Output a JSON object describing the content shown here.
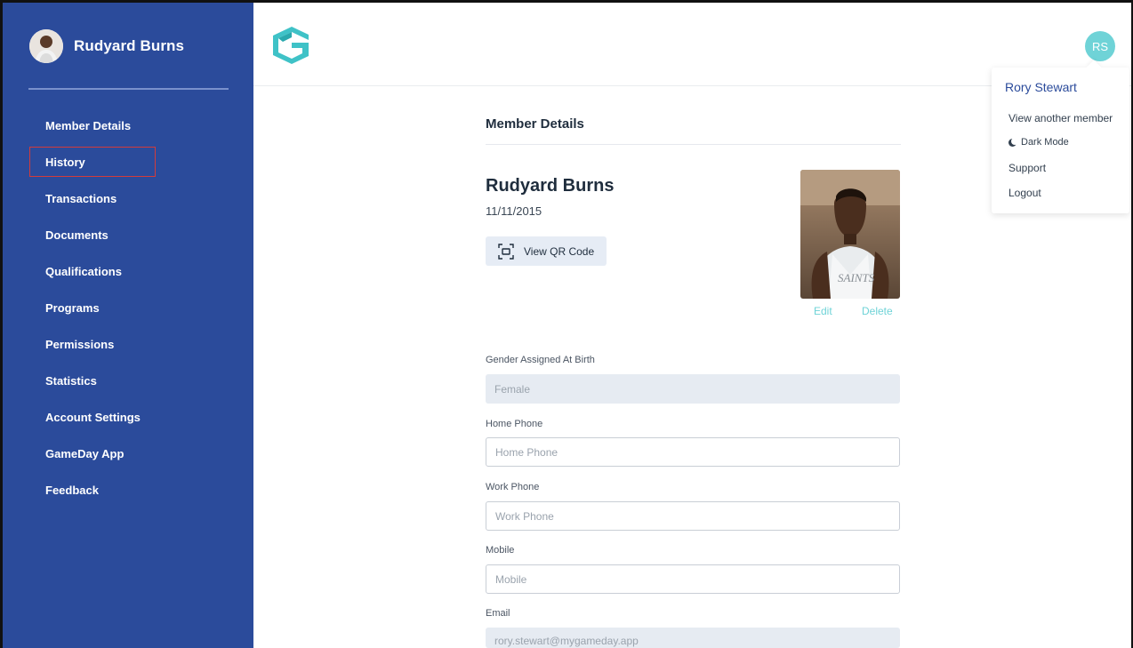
{
  "sidebar": {
    "profile_name": "Rudyard Burns",
    "items": [
      {
        "label": "Member Details"
      },
      {
        "label": "History"
      },
      {
        "label": "Transactions"
      },
      {
        "label": "Documents"
      },
      {
        "label": "Qualifications"
      },
      {
        "label": "Programs"
      },
      {
        "label": "Permissions"
      },
      {
        "label": "Statistics"
      },
      {
        "label": "Account Settings"
      },
      {
        "label": "GameDay App"
      },
      {
        "label": "Feedback"
      }
    ]
  },
  "header": {
    "user_initials": "RS"
  },
  "dropdown": {
    "name": "Rory Stewart",
    "items": [
      "View another member",
      "Dark Mode",
      "Support",
      "Logout"
    ]
  },
  "main": {
    "title": "Member Details",
    "member_name": "Rudyard Burns",
    "dob": "11/11/2015",
    "qr_label": "View QR Code",
    "photo_edit": "Edit",
    "photo_delete": "Delete",
    "fields": {
      "gender_label": "Gender Assigned At Birth",
      "gender_value": "Female",
      "home_label": "Home Phone",
      "home_placeholder": "Home Phone",
      "work_label": "Work Phone",
      "work_placeholder": "Work Phone",
      "mobile_label": "Mobile",
      "mobile_placeholder": "Mobile",
      "email_label": "Email",
      "email_value": "rory.stewart@mygameday.app"
    }
  },
  "colors": {
    "sidebar": "#2b4b9b",
    "accent": "#6fd3d7",
    "highlight_border": "#d23b3b"
  }
}
